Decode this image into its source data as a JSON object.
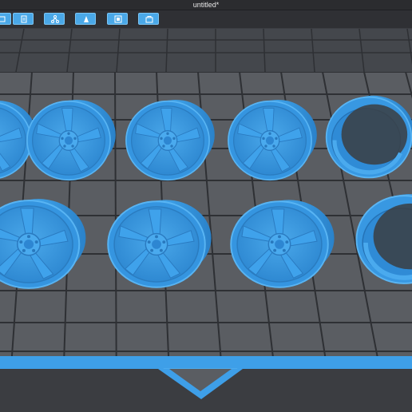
{
  "window": {
    "title": "untitled*"
  },
  "toolbar": {
    "buttons": [
      {
        "icon": "open-file-icon"
      },
      {
        "icon": "document-icon"
      },
      {
        "icon": "support-tree-icon"
      },
      {
        "icon": "slice-icon"
      },
      {
        "icon": "frame-icon"
      },
      {
        "icon": "export-icon"
      }
    ]
  },
  "scene": {
    "plate_color": "#5a5d62",
    "grid_color": "#2e3034",
    "model_color": "#2f8fdc",
    "model_highlight": "#5cb6f5",
    "edge_color": "#3a9bea",
    "rows": [
      {
        "row": "back",
        "wheels": [
          "wheel-partial-left",
          "wheel",
          "wheel",
          "wheel",
          "rim-barrel"
        ]
      },
      {
        "row": "front",
        "wheels": [
          "wheel-partial-left",
          "wheel",
          "wheel",
          "rim-barrel-partial-right"
        ]
      }
    ]
  }
}
